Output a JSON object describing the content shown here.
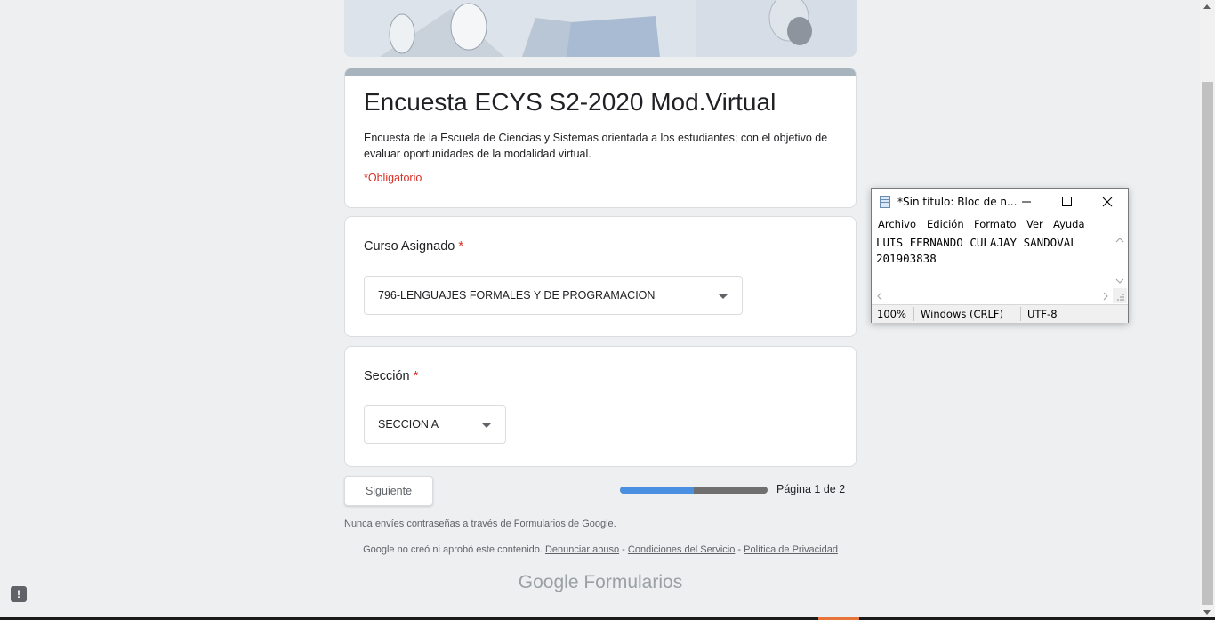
{
  "form": {
    "title": "Encuesta ECYS S2-2020 Mod.Virtual",
    "description": "Encuesta de la Escuela de Ciencias y Sistemas orientada a los estudiantes; con el objetivo de evaluar oportunidades de la modalidad virtual.",
    "required_note": "*Obligatorio",
    "questions": [
      {
        "title": "Curso Asignado",
        "required_mark": "*",
        "selected": "796-LENGUAJES FORMALES Y DE PROGRAMACION"
      },
      {
        "title": "Sección",
        "required_mark": "*",
        "selected": "SECCION A"
      }
    ],
    "next_button": "Siguiente",
    "progress_fraction": 0.5,
    "page_indicator": "Página 1 de 2",
    "password_warning": "Nunca envíes contraseñas a través de Formularios de Google.",
    "disclaimer": "Google no creó ni aprobó este contenido.",
    "links": [
      "Denunciar abuso",
      "Condiciones del Servicio",
      "Política de Privacidad"
    ],
    "link_separator": "-",
    "brand_google": "Google",
    "brand_product": "Formularios"
  },
  "notepad": {
    "title": "*Sin título: Bloc de n...",
    "menu": [
      "Archivo",
      "Edición",
      "Formato",
      "Ver",
      "Ayuda"
    ],
    "content_lines": [
      "LUIS FERNANDO CULAJAY SANDOVAL",
      "201903838"
    ],
    "status": {
      "zoom": "100%",
      "line_ending": "Windows (CRLF)",
      "encoding": "UTF-8"
    }
  },
  "colors": {
    "page_bg": "#edeff1",
    "required": "#d93025",
    "progress_fill": "#4a90e2",
    "progress_track": "#6f6f6f",
    "title_bar": "#a7b4be"
  },
  "icons": {
    "report": "report-problem-icon",
    "dropdown": "arrow-drop-down-icon",
    "notepad_app": "notepad-icon"
  }
}
